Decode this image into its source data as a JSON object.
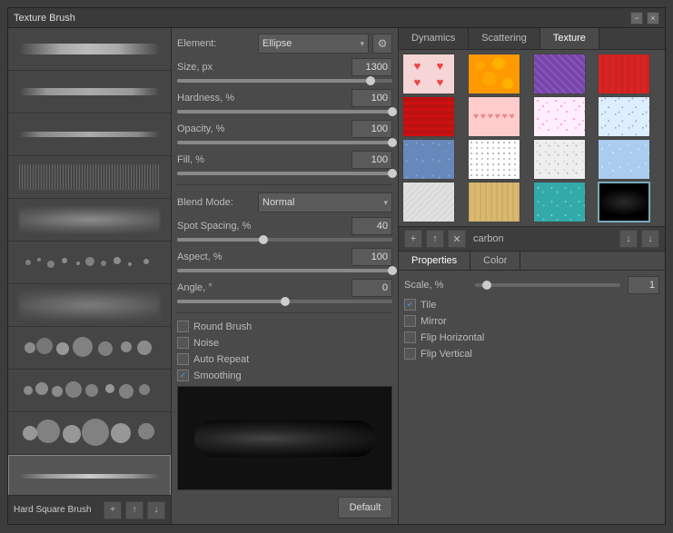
{
  "window": {
    "title": "Texture Brush",
    "close_label": "×",
    "minimize_label": "−"
  },
  "brush_list": {
    "items": [
      {
        "id": 1,
        "style": "stroke-1"
      },
      {
        "id": 2,
        "style": "stroke-2"
      },
      {
        "id": 3,
        "style": "stroke-3"
      },
      {
        "id": 4,
        "style": "stroke-4"
      },
      {
        "id": 5,
        "style": "stroke-5"
      },
      {
        "id": 6,
        "style": "stroke-6"
      },
      {
        "id": 7,
        "style": "stroke-7"
      },
      {
        "id": 8,
        "style": "stroke-8"
      },
      {
        "id": 9,
        "style": "stroke-9"
      },
      {
        "id": 10,
        "style": "stroke-10"
      },
      {
        "id": 11,
        "style": "stroke-11"
      },
      {
        "id": 12,
        "style": "stroke-12"
      }
    ],
    "selected_name": "Hard Square Brush",
    "add_icon": "+",
    "upload_icon": "↑",
    "download_icon": "↓"
  },
  "controls": {
    "element_label": "Element:",
    "element_value": "Ellipse",
    "size_label": "Size, px",
    "size_value": "1300",
    "hardness_label": "Hardness, %",
    "hardness_value": "100",
    "opacity_label": "Opacity, %",
    "opacity_value": "100",
    "fill_label": "Fill, %",
    "fill_value": "100",
    "blend_mode_label": "Blend Mode:",
    "blend_mode_value": "Normal",
    "spot_spacing_label": "Spot Spacing, %",
    "spot_spacing_value": "40",
    "aspect_label": "Aspect, %",
    "aspect_value": "100",
    "angle_label": "Angle, °",
    "angle_value": "0",
    "checkboxes": {
      "round_brush_label": "Round Brush",
      "round_brush_checked": false,
      "noise_label": "Noise",
      "noise_checked": false,
      "auto_repeat_label": "Auto Repeat",
      "auto_repeat_checked": false,
      "smoothing_label": "Smoothing",
      "smoothing_checked": true
    },
    "default_btn": "Default",
    "gear_icon": "⚙"
  },
  "right_panel": {
    "tabs": [
      {
        "label": "Dynamics",
        "active": false
      },
      {
        "label": "Scattering",
        "active": false
      },
      {
        "label": "Texture",
        "active": true
      }
    ],
    "textures": [
      {
        "id": 1,
        "color": "#f5d5d5",
        "pattern": "hearts",
        "selected": false
      },
      {
        "id": 2,
        "color": "#f90",
        "pattern": "orange",
        "selected": false
      },
      {
        "id": 3,
        "color": "#7744aa",
        "pattern": "purple",
        "selected": false
      },
      {
        "id": 4,
        "color": "#cc2222",
        "pattern": "red",
        "selected": false
      },
      {
        "id": 5,
        "color": "#bb1111",
        "pattern": "red2",
        "selected": false
      },
      {
        "id": 6,
        "color": "#ffcccc",
        "pattern": "pink-hearts",
        "selected": false
      },
      {
        "id": 7,
        "color": "#ffdddd",
        "pattern": "pink-dots",
        "selected": false
      },
      {
        "id": 8,
        "color": "#ffeeff",
        "pattern": "light-pink",
        "selected": false
      },
      {
        "id": 9,
        "color": "#6688bb",
        "pattern": "blue",
        "selected": false
      },
      {
        "id": 10,
        "color": "#ffffff",
        "pattern": "dots",
        "selected": false
      },
      {
        "id": 11,
        "color": "#eeeeee",
        "pattern": "dots2",
        "selected": false
      },
      {
        "id": 12,
        "color": "#aaccee",
        "pattern": "water",
        "selected": false
      },
      {
        "id": 13,
        "color": "#eeeeee",
        "pattern": "gray1",
        "selected": false
      },
      {
        "id": 14,
        "color": "#dab870",
        "pattern": "tan",
        "selected": false
      },
      {
        "id": 15,
        "color": "#33aaaa",
        "pattern": "teal",
        "selected": false
      },
      {
        "id": 16,
        "color": "#111111",
        "pattern": "black",
        "selected": true
      }
    ],
    "texture_toolbar": {
      "add_icon": "+",
      "upload_icon": "↑",
      "delete_icon": "✕",
      "texture_name": "carbon",
      "download_icon": "↓",
      "download2_icon": "↓"
    },
    "sub_tabs": [
      {
        "label": "Properties",
        "active": true
      },
      {
        "label": "Color",
        "active": false
      }
    ],
    "properties": {
      "scale_label": "Scale, %",
      "scale_value": "1",
      "scale_slider_pct": 5,
      "tile_label": "Tile",
      "tile_checked": true,
      "mirror_label": "Mirror",
      "mirror_checked": false,
      "flip_h_label": "Flip Horizontal",
      "flip_h_checked": false,
      "flip_v_label": "Flip Vertical",
      "flip_v_checked": false
    }
  }
}
